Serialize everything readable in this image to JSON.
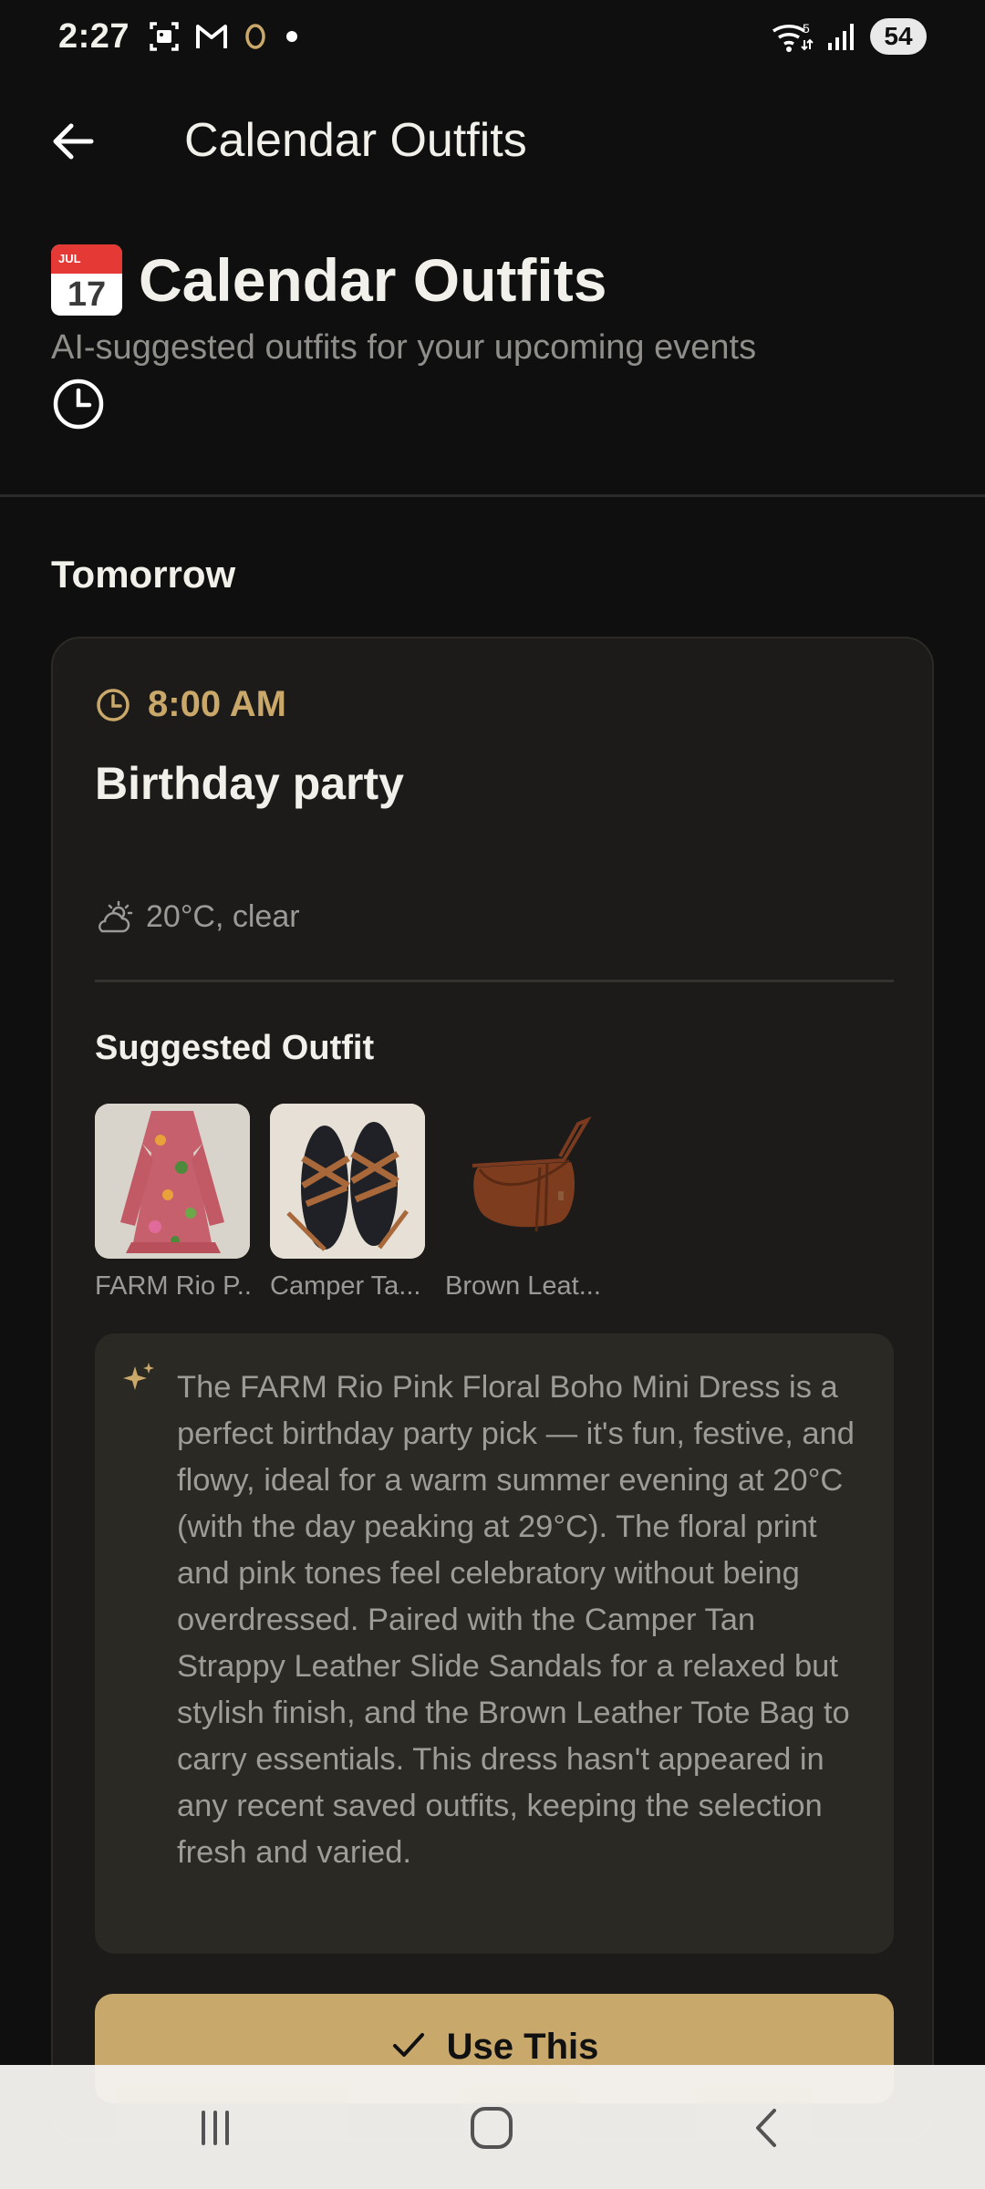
{
  "status_bar": {
    "time": "2:27",
    "battery": "54",
    "icons": [
      "screenshot-icon",
      "gmail-icon",
      "app-o-icon",
      "dot-icon",
      "wifi-icon",
      "signal-icon"
    ]
  },
  "app_bar": {
    "title": "Calendar Outfits",
    "back_icon": "arrow-left-icon"
  },
  "header": {
    "emoji_month": "JUL",
    "emoji_day": "17",
    "title": "Calendar Outfits",
    "subtitle": "AI-suggested outfits for your upcoming events"
  },
  "section": {
    "label": "Tomorrow"
  },
  "event": {
    "time": "8:00 AM",
    "title": "Birthday party",
    "weather": "20°C, clear",
    "suggested_label": "Suggested Outfit",
    "items": [
      {
        "label": "FARM Rio P..."
      },
      {
        "label": "Camper Ta..."
      },
      {
        "label": "Brown Leat..."
      }
    ],
    "reason": "The FARM Rio Pink Floral Boho Mini Dress is a perfect birthday party pick — it's fun, festive, and flowy, ideal for a warm summer evening at 20°C (with the day peaking at 29°C). The floral print and pink tones feel celebratory without being overdressed. Paired with the Camper Tan Strappy Leather Slide Sandals for a relaxed but stylish finish, and the Brown Leather Tote Bag to carry essentials. This dress hasn't appeared in any recent saved outfits, keeping the selection fresh and varied.",
    "use_button": "Use This"
  },
  "colors": {
    "accent": "#c9a96b",
    "background": "#0f0f0f",
    "card": "#1c1b19",
    "reason_box": "#2b2924"
  }
}
